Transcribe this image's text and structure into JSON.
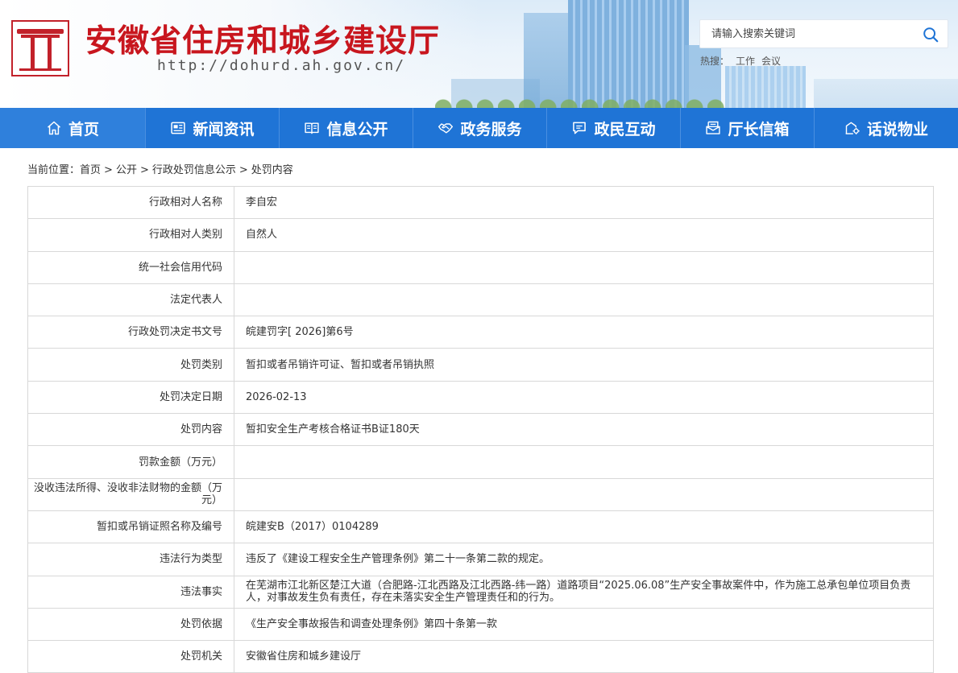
{
  "header": {
    "title": "安徽省住房和城乡建设厅",
    "url": "http://dohurd.ah.gov.cn/",
    "search_placeholder": "请输入搜索关键词",
    "hot_label": "热搜：",
    "hot_words": [
      "工作",
      "会议"
    ]
  },
  "nav": {
    "items": [
      {
        "label": "首页",
        "icon": "home-icon"
      },
      {
        "label": "新闻资讯",
        "icon": "news-icon"
      },
      {
        "label": "信息公开",
        "icon": "book-icon"
      },
      {
        "label": "政务服务",
        "icon": "handshake-icon"
      },
      {
        "label": "政民互动",
        "icon": "chat-icon"
      },
      {
        "label": "厅长信箱",
        "icon": "mailbox-icon"
      },
      {
        "label": "话说物业",
        "icon": "building-gear-icon"
      }
    ]
  },
  "breadcrumb": {
    "prefix": "当前位置：",
    "items": [
      "首页",
      "公开",
      "行政处罚信息公示",
      "处罚内容"
    ],
    "separator": ">"
  },
  "record": {
    "rows": [
      {
        "label": "行政相对人名称",
        "value": "李自宏"
      },
      {
        "label": "行政相对人类别",
        "value": "自然人"
      },
      {
        "label": "统一社会信用代码",
        "value": ""
      },
      {
        "label": "法定代表人",
        "value": ""
      },
      {
        "label": "行政处罚决定书文号",
        "value": "皖建罚字[ 2026]第6号"
      },
      {
        "label": "处罚类别",
        "value": "暂扣或者吊销许可证、暂扣或者吊销执照"
      },
      {
        "label": "处罚决定日期",
        "value": "2026-02-13"
      },
      {
        "label": "处罚内容",
        "value": "暂扣安全生产考核合格证书B证180天"
      },
      {
        "label": "罚款金额（万元）",
        "value": ""
      },
      {
        "label": "没收违法所得、没收非法财物的金额（万元）",
        "value": ""
      },
      {
        "label": "暂扣或吊销证照名称及编号",
        "value": "皖建安B（2017）0104289"
      },
      {
        "label": "违法行为类型",
        "value": "违反了《建设工程安全生产管理条例》第二十一条第二款的规定。"
      },
      {
        "label": "违法事实",
        "value": "在芜湖市江北新区楚江大道（合肥路-江北西路及江北西路-纬一路）道路项目“2025.06.08”生产安全事故案件中，作为施工总承包单位项目负责人，对事故发生负有责任，存在未落实安全生产管理责任和的行为。"
      },
      {
        "label": "处罚依据",
        "value": "《生产安全事故报告和调查处理条例》第四十条第一款"
      },
      {
        "label": "处罚机关",
        "value": "安徽省住房和城乡建设厅"
      }
    ]
  },
  "colors": {
    "brand_red": "#c8161e",
    "nav_blue": "#1f74d6",
    "border": "#d8d8d8"
  }
}
